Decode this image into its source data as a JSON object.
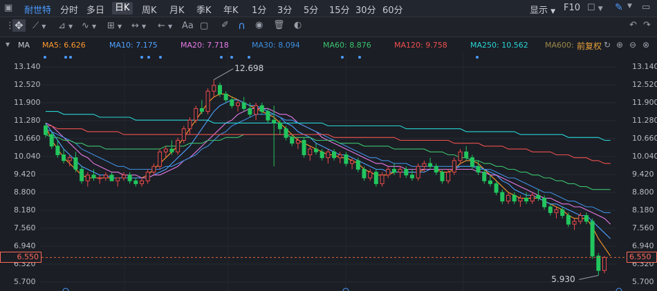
{
  "toolbar": {
    "stock_name": "耐世特",
    "periods": [
      "分时",
      "多日",
      "日K",
      "周K",
      "月K",
      "季K",
      "年K",
      "1分",
      "3分",
      "5分",
      "15分",
      "30分",
      "60分"
    ],
    "active_period": "日K",
    "display_label": "显示",
    "f10_label": "F10"
  },
  "ma_bar": {
    "indicator": "MA",
    "items": [
      {
        "label": "MA5: 6.626",
        "color": "#ff9a2e"
      },
      {
        "label": "MA10: 7.175",
        "color": "#4fa3ff"
      },
      {
        "label": "MA20: 7.718",
        "color": "#e87be8"
      },
      {
        "label": "MA30: 8.094",
        "color": "#3f8fe0"
      },
      {
        "label": "MA60: 8.876",
        "color": "#3cc46e"
      },
      {
        "label": "MA120: 9.758",
        "color": "#f0504e"
      },
      {
        "label": "MA250: 10.562",
        "color": "#27d6d6"
      },
      {
        "label": "MA600:",
        "color": "#9e8a4a"
      }
    ],
    "adjust_label": "前复权"
  },
  "chart_data": {
    "type": "candlestick",
    "y_ticks": [
      13.14,
      12.52,
      11.9,
      11.28,
      10.66,
      10.04,
      9.42,
      8.8,
      8.18,
      7.56,
      6.94,
      6.32,
      5.7
    ],
    "ylim": [
      5.55,
      13.4
    ],
    "current_price": "6.550",
    "high_label": "12.698",
    "low_label": "5.930",
    "candles": [
      [
        11.1,
        11.2,
        10.7,
        10.8
      ],
      [
        10.8,
        10.9,
        10.3,
        10.4
      ],
      [
        10.4,
        10.6,
        10.0,
        10.1
      ],
      [
        10.1,
        10.3,
        9.8,
        9.9
      ],
      [
        9.9,
        10.1,
        9.7,
        10.0
      ],
      [
        10.0,
        10.2,
        9.5,
        9.6
      ],
      [
        9.6,
        9.7,
        9.1,
        9.2
      ],
      [
        9.2,
        9.5,
        9.0,
        9.4
      ],
      [
        9.4,
        9.6,
        9.2,
        9.3
      ],
      [
        9.3,
        9.4,
        9.1,
        9.3
      ],
      [
        9.3,
        9.5,
        9.2,
        9.4
      ],
      [
        9.4,
        9.5,
        9.2,
        9.2
      ],
      [
        9.2,
        9.3,
        9.0,
        9.3
      ],
      [
        9.3,
        9.5,
        9.2,
        9.4
      ],
      [
        9.4,
        9.5,
        9.1,
        9.2
      ],
      [
        9.2,
        9.3,
        9.0,
        9.1
      ],
      [
        9.1,
        9.3,
        9.0,
        9.2
      ],
      [
        9.2,
        9.6,
        9.1,
        9.5
      ],
      [
        9.5,
        9.8,
        9.4,
        9.7
      ],
      [
        9.7,
        10.3,
        9.6,
        10.2
      ],
      [
        10.2,
        10.4,
        10.0,
        10.3
      ],
      [
        10.3,
        10.6,
        10.1,
        10.2
      ],
      [
        10.2,
        10.7,
        10.1,
        10.6
      ],
      [
        10.6,
        11.1,
        10.5,
        11.0
      ],
      [
        11.0,
        11.4,
        10.8,
        11.3
      ],
      [
        11.3,
        11.8,
        11.2,
        11.7
      ],
      [
        11.7,
        12.0,
        11.5,
        11.6
      ],
      [
        11.6,
        12.4,
        11.5,
        12.3
      ],
      [
        12.3,
        12.698,
        12.1,
        12.5
      ],
      [
        12.5,
        12.6,
        12.1,
        12.2
      ],
      [
        12.2,
        12.3,
        11.9,
        12.0
      ],
      [
        12.0,
        12.1,
        11.7,
        11.8
      ],
      [
        11.8,
        12.0,
        11.6,
        11.9
      ],
      [
        11.9,
        12.1,
        11.6,
        11.7
      ],
      [
        11.7,
        11.9,
        11.4,
        11.5
      ],
      [
        11.5,
        11.9,
        11.3,
        11.8
      ],
      [
        11.8,
        11.9,
        11.5,
        11.6
      ],
      [
        11.6,
        11.7,
        11.2,
        11.3
      ],
      [
        11.3,
        11.8,
        9.7,
        11.2
      ],
      [
        11.2,
        11.3,
        10.8,
        11.0
      ],
      [
        11.0,
        11.1,
        10.6,
        10.7
      ],
      [
        10.7,
        10.8,
        10.4,
        10.5
      ],
      [
        10.5,
        10.7,
        10.3,
        10.6
      ],
      [
        10.6,
        10.7,
        10.0,
        10.1
      ],
      [
        10.1,
        10.4,
        9.9,
        10.3
      ],
      [
        10.3,
        10.5,
        10.1,
        10.2
      ],
      [
        10.2,
        10.3,
        9.9,
        10.0
      ],
      [
        10.0,
        10.3,
        9.8,
        10.2
      ],
      [
        10.2,
        10.3,
        9.9,
        10.0
      ],
      [
        10.0,
        10.2,
        9.8,
        10.1
      ],
      [
        10.1,
        10.2,
        9.7,
        9.8
      ],
      [
        9.8,
        10.0,
        9.6,
        9.9
      ],
      [
        9.9,
        10.0,
        9.5,
        9.6
      ],
      [
        9.6,
        9.7,
        9.2,
        9.3
      ],
      [
        9.3,
        9.6,
        9.2,
        9.5
      ],
      [
        9.5,
        9.6,
        9.0,
        9.1
      ],
      [
        9.1,
        9.5,
        9.0,
        9.4
      ],
      [
        9.4,
        9.7,
        9.3,
        9.6
      ],
      [
        9.6,
        9.8,
        9.4,
        9.5
      ],
      [
        9.5,
        9.7,
        9.3,
        9.6
      ],
      [
        9.6,
        9.7,
        9.3,
        9.4
      ],
      [
        9.4,
        9.6,
        9.2,
        9.3
      ],
      [
        9.3,
        9.8,
        9.2,
        9.7
      ],
      [
        9.7,
        9.9,
        9.5,
        9.8
      ],
      [
        9.8,
        10.0,
        9.6,
        9.7
      ],
      [
        9.7,
        9.8,
        9.4,
        9.5
      ],
      [
        9.5,
        9.6,
        9.1,
        9.2
      ],
      [
        9.2,
        9.6,
        9.1,
        9.5
      ],
      [
        9.5,
        10.0,
        9.4,
        9.9
      ],
      [
        9.9,
        10.3,
        9.8,
        10.2
      ],
      [
        10.2,
        10.4,
        9.9,
        10.0
      ],
      [
        10.0,
        10.1,
        9.6,
        9.7
      ],
      [
        9.7,
        9.9,
        9.4,
        9.5
      ],
      [
        9.5,
        9.6,
        9.1,
        9.2
      ],
      [
        9.2,
        9.4,
        9.0,
        9.1
      ],
      [
        9.1,
        9.2,
        8.7,
        8.8
      ],
      [
        8.8,
        8.9,
        8.4,
        8.5
      ],
      [
        8.5,
        8.8,
        8.4,
        8.7
      ],
      [
        8.7,
        8.8,
        8.4,
        8.5
      ],
      [
        8.5,
        8.7,
        8.3,
        8.6
      ],
      [
        8.6,
        8.8,
        8.4,
        8.5
      ],
      [
        8.5,
        8.8,
        8.4,
        8.7
      ],
      [
        8.7,
        8.9,
        8.5,
        8.6
      ],
      [
        8.6,
        8.7,
        8.2,
        8.3
      ],
      [
        8.3,
        8.4,
        8.0,
        8.1
      ],
      [
        8.1,
        8.3,
        7.9,
        8.2
      ],
      [
        8.2,
        8.3,
        7.9,
        8.0
      ],
      [
        8.0,
        8.1,
        7.6,
        7.7
      ],
      [
        7.7,
        7.9,
        7.5,
        7.8
      ],
      [
        7.8,
        8.1,
        7.7,
        8.0
      ],
      [
        8.0,
        8.1,
        7.7,
        7.8
      ],
      [
        7.8,
        7.9,
        6.5,
        6.6
      ],
      [
        6.6,
        6.7,
        5.93,
        6.1
      ],
      [
        6.1,
        6.6,
        6.0,
        6.55
      ]
    ],
    "ma_series": [
      {
        "name": "MA5",
        "color": "#ff9a2e",
        "values": [
          11.1,
          10.6,
          10.3,
          10.0,
          9.8,
          9.6,
          9.4,
          9.3,
          9.3,
          9.3,
          9.3,
          9.3,
          9.3,
          9.3,
          9.3,
          9.3,
          9.3,
          9.4,
          9.6,
          9.8,
          10.0,
          10.2,
          10.4,
          10.7,
          11.0,
          11.3,
          11.6,
          11.9,
          12.1,
          12.2,
          12.2,
          12.1,
          12.0,
          11.9,
          11.8,
          11.7,
          11.6,
          11.5,
          11.4,
          11.2,
          11.0,
          10.8,
          10.6,
          10.5,
          10.4,
          10.3,
          10.2,
          10.1,
          10.1,
          10.0,
          10.0,
          9.9,
          9.8,
          9.6,
          9.5,
          9.4,
          9.4,
          9.4,
          9.5,
          9.5,
          9.5,
          9.5,
          9.5,
          9.6,
          9.6,
          9.6,
          9.5,
          9.5,
          9.6,
          9.8,
          9.9,
          9.9,
          9.8,
          9.6,
          9.4,
          9.2,
          9.0,
          8.8,
          8.7,
          8.6,
          8.6,
          8.6,
          8.6,
          8.5,
          8.4,
          8.3,
          8.2,
          8.0,
          7.9,
          7.9,
          7.9,
          7.6,
          7.2,
          6.9,
          6.6
        ]
      },
      {
        "name": "MA10",
        "color": "#4fa3ff",
        "values": [
          11.2,
          10.9,
          10.6,
          10.3,
          10.1,
          9.9,
          9.7,
          9.6,
          9.5,
          9.4,
          9.4,
          9.3,
          9.3,
          9.3,
          9.3,
          9.3,
          9.3,
          9.3,
          9.4,
          9.5,
          9.6,
          9.8,
          10.0,
          10.2,
          10.4,
          10.7,
          11.0,
          11.3,
          11.6,
          11.8,
          11.9,
          12.0,
          12.0,
          11.9,
          11.8,
          11.8,
          11.7,
          11.6,
          11.5,
          11.4,
          11.2,
          11.1,
          10.9,
          10.8,
          10.7,
          10.5,
          10.4,
          10.3,
          10.2,
          10.1,
          10.1,
          10.0,
          9.9,
          9.8,
          9.7,
          9.6,
          9.6,
          9.5,
          9.5,
          9.5,
          9.5,
          9.5,
          9.5,
          9.5,
          9.6,
          9.6,
          9.6,
          9.6,
          9.6,
          9.7,
          9.7,
          9.7,
          9.7,
          9.6,
          9.5,
          9.4,
          9.2,
          9.1,
          8.9,
          8.8,
          8.7,
          8.7,
          8.6,
          8.5,
          8.4,
          8.4,
          8.3,
          8.2,
          8.1,
          8.0,
          8.0,
          7.8,
          7.6,
          7.4,
          7.2
        ]
      },
      {
        "name": "MA20",
        "color": "#e87be8",
        "values": [
          11.2,
          11.1,
          10.9,
          10.7,
          10.5,
          10.3,
          10.1,
          10.0,
          9.8,
          9.7,
          9.6,
          9.5,
          9.5,
          9.4,
          9.4,
          9.4,
          9.3,
          9.3,
          9.4,
          9.4,
          9.5,
          9.6,
          9.7,
          9.9,
          10.0,
          10.2,
          10.4,
          10.6,
          10.8,
          11.0,
          11.2,
          11.3,
          11.5,
          11.6,
          11.7,
          11.7,
          11.7,
          11.7,
          11.6,
          11.5,
          11.5,
          11.4,
          11.2,
          11.1,
          11.0,
          10.9,
          10.7,
          10.6,
          10.5,
          10.4,
          10.3,
          10.2,
          10.1,
          10.0,
          9.9,
          9.8,
          9.8,
          9.7,
          9.7,
          9.7,
          9.6,
          9.6,
          9.6,
          9.6,
          9.6,
          9.6,
          9.6,
          9.6,
          9.6,
          9.6,
          9.6,
          9.6,
          9.5,
          9.5,
          9.4,
          9.4,
          9.3,
          9.2,
          9.1,
          9.0,
          8.9,
          8.8,
          8.7,
          8.6,
          8.6,
          8.5,
          8.4,
          8.4,
          8.3,
          8.3,
          8.2,
          8.1,
          8.0,
          7.9,
          7.7
        ]
      },
      {
        "name": "MA30",
        "color": "#3f8fe0",
        "values": [
          11.0,
          10.9,
          10.8,
          10.7,
          10.6,
          10.5,
          10.3,
          10.2,
          10.1,
          10.0,
          9.9,
          9.8,
          9.7,
          9.7,
          9.6,
          9.6,
          9.6,
          9.6,
          9.6,
          9.6,
          9.7,
          9.7,
          9.8,
          9.9,
          10.0,
          10.1,
          10.3,
          10.4,
          10.6,
          10.8,
          10.9,
          11.1,
          11.2,
          11.3,
          11.4,
          11.5,
          11.5,
          11.5,
          11.5,
          11.4,
          11.3,
          11.3,
          11.2,
          11.1,
          11.0,
          10.9,
          10.8,
          10.7,
          10.6,
          10.5,
          10.4,
          10.3,
          10.2,
          10.1,
          10.0,
          10.0,
          9.9,
          9.9,
          9.8,
          9.8,
          9.8,
          9.7,
          9.7,
          9.7,
          9.7,
          9.7,
          9.7,
          9.7,
          9.7,
          9.7,
          9.7,
          9.7,
          9.6,
          9.6,
          9.6,
          9.5,
          9.4,
          9.3,
          9.3,
          9.2,
          9.1,
          9.0,
          8.9,
          8.8,
          8.8,
          8.7,
          8.6,
          8.5,
          8.5,
          8.4,
          8.3,
          8.3,
          8.2,
          8.1,
          8.1
        ]
      },
      {
        "name": "MA60",
        "color": "#3cc46e",
        "values": [
          10.8,
          10.7,
          10.7,
          10.6,
          10.6,
          10.5,
          10.5,
          10.4,
          10.4,
          10.4,
          10.3,
          10.3,
          10.3,
          10.3,
          10.3,
          10.3,
          10.3,
          10.3,
          10.3,
          10.3,
          10.4,
          10.4,
          10.4,
          10.4,
          10.5,
          10.5,
          10.5,
          10.6,
          10.6,
          10.6,
          10.7,
          10.7,
          10.7,
          10.8,
          10.8,
          10.8,
          10.8,
          10.8,
          10.8,
          10.8,
          10.8,
          10.7,
          10.7,
          10.7,
          10.7,
          10.6,
          10.6,
          10.6,
          10.6,
          10.5,
          10.5,
          10.5,
          10.5,
          10.4,
          10.4,
          10.4,
          10.4,
          10.4,
          10.3,
          10.3,
          10.3,
          10.3,
          10.3,
          10.3,
          10.2,
          10.2,
          10.2,
          10.1,
          10.1,
          10.0,
          10.0,
          9.9,
          9.9,
          9.8,
          9.8,
          9.7,
          9.7,
          9.6,
          9.6,
          9.5,
          9.5,
          9.4,
          9.4,
          9.3,
          9.3,
          9.2,
          9.2,
          9.1,
          9.1,
          9.0,
          9.0,
          8.9,
          8.9,
          8.9,
          8.9
        ]
      },
      {
        "name": "MA120",
        "color": "#f0504e",
        "values": [
          11.1,
          11.1,
          11.0,
          11.0,
          11.0,
          11.0,
          11.0,
          10.9,
          10.9,
          10.9,
          10.9,
          10.9,
          10.9,
          10.8,
          10.8,
          10.8,
          10.8,
          10.8,
          10.8,
          10.8,
          10.8,
          10.8,
          10.8,
          10.8,
          10.8,
          10.8,
          10.8,
          10.8,
          10.8,
          10.8,
          10.8,
          10.8,
          10.8,
          10.8,
          10.8,
          10.8,
          10.8,
          10.8,
          10.8,
          10.8,
          10.8,
          10.8,
          10.8,
          10.8,
          10.8,
          10.8,
          10.8,
          10.8,
          10.7,
          10.7,
          10.7,
          10.7,
          10.7,
          10.7,
          10.7,
          10.7,
          10.7,
          10.7,
          10.7,
          10.6,
          10.6,
          10.6,
          10.6,
          10.6,
          10.6,
          10.6,
          10.6,
          10.6,
          10.5,
          10.5,
          10.5,
          10.5,
          10.5,
          10.4,
          10.4,
          10.4,
          10.4,
          10.3,
          10.3,
          10.3,
          10.3,
          10.2,
          10.2,
          10.2,
          10.2,
          10.1,
          10.1,
          10.1,
          10.0,
          10.0,
          10.0,
          9.9,
          9.9,
          9.8,
          9.8
        ]
      },
      {
        "name": "MA250",
        "color": "#27d6d6",
        "values": [
          11.6,
          11.6,
          11.6,
          11.5,
          11.5,
          11.5,
          11.5,
          11.5,
          11.5,
          11.4,
          11.4,
          11.4,
          11.4,
          11.4,
          11.4,
          11.3,
          11.3,
          11.3,
          11.3,
          11.3,
          11.3,
          11.3,
          11.3,
          11.3,
          11.3,
          11.3,
          11.3,
          11.3,
          11.2,
          11.2,
          11.2,
          11.2,
          11.2,
          11.2,
          11.2,
          11.2,
          11.2,
          11.2,
          11.2,
          11.2,
          11.2,
          11.2,
          11.2,
          11.2,
          11.2,
          11.2,
          11.2,
          11.1,
          11.1,
          11.1,
          11.1,
          11.1,
          11.1,
          11.1,
          11.1,
          11.1,
          11.1,
          11.1,
          11.1,
          11.1,
          11.0,
          11.0,
          11.0,
          11.0,
          11.0,
          11.0,
          11.0,
          11.0,
          11.0,
          11.0,
          10.9,
          10.9,
          10.9,
          10.9,
          10.9,
          10.9,
          10.9,
          10.9,
          10.9,
          10.8,
          10.8,
          10.8,
          10.8,
          10.8,
          10.8,
          10.8,
          10.8,
          10.7,
          10.7,
          10.7,
          10.7,
          10.7,
          10.7,
          10.6,
          10.6
        ]
      }
    ],
    "up_color": "#ef4b4b",
    "down_color": "#22c55e"
  }
}
